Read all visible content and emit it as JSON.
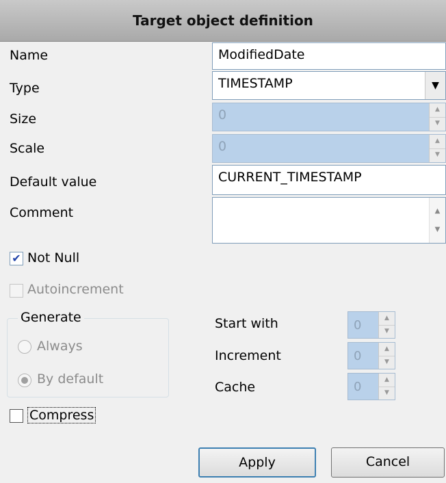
{
  "header": {
    "title": "Target object definition"
  },
  "fields": {
    "name": {
      "label": "Name",
      "value": "ModifiedDate"
    },
    "type": {
      "label": "Type",
      "value": "TIMESTAMP"
    },
    "size": {
      "label": "Size",
      "value": "0"
    },
    "scale": {
      "label": "Scale",
      "value": "0"
    },
    "default_value": {
      "label": "Default value",
      "value": "CURRENT_TIMESTAMP"
    },
    "comment": {
      "label": "Comment",
      "value": ""
    }
  },
  "checks": {
    "not_null": {
      "label": "Not Null",
      "checked": true
    },
    "autoincrement": {
      "label": "Autoincrement",
      "checked": false
    },
    "compress": {
      "label": "Compress",
      "checked": false
    }
  },
  "generate": {
    "title": "Generate",
    "options": [
      {
        "label": "Always",
        "selected": false
      },
      {
        "label": "By default",
        "selected": true
      }
    ]
  },
  "sequence": {
    "start_with": {
      "label": "Start with",
      "value": "0"
    },
    "increment": {
      "label": "Increment",
      "value": "0"
    },
    "cache": {
      "label": "Cache",
      "value": "0"
    }
  },
  "buttons": {
    "apply": "Apply",
    "cancel": "Cancel"
  },
  "colors": {
    "disabled_field": "#b9d1ea",
    "header": "#b4b4b4",
    "focus_border": "#3c7fb1"
  }
}
